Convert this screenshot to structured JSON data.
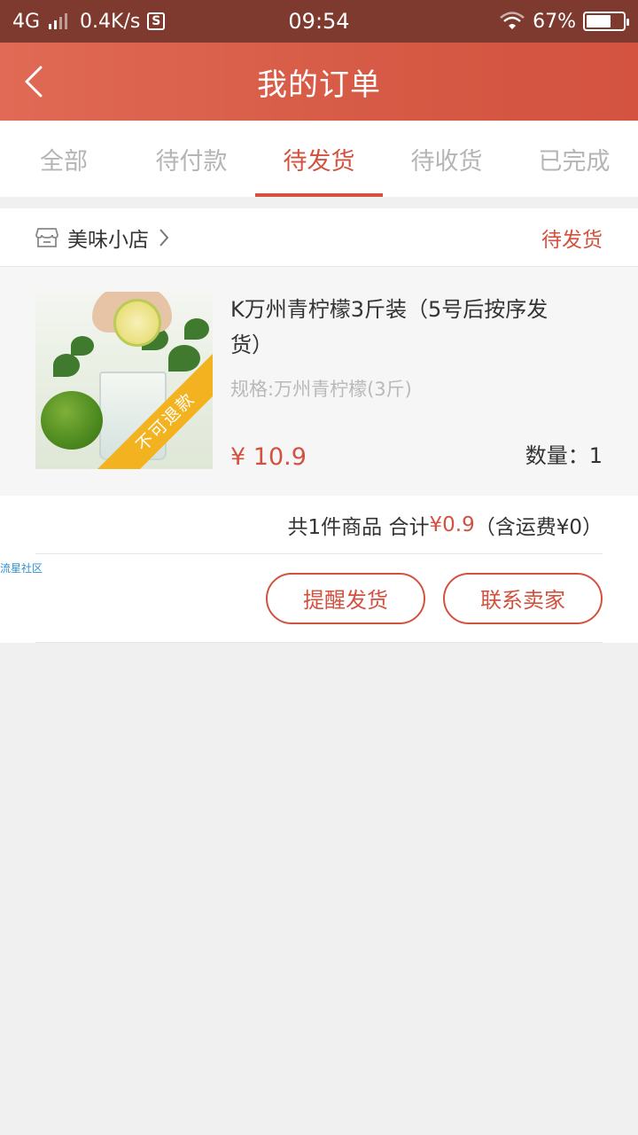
{
  "status_bar": {
    "network": "4G",
    "speed": "0.4K/s",
    "sim_icon": "S",
    "time": "09:54",
    "battery": "67%",
    "battery_level": 0.67
  },
  "nav": {
    "title": "我的订单",
    "back_icon": "chevron-left-icon"
  },
  "tabs": [
    {
      "label": "全部",
      "active": false
    },
    {
      "label": "待付款",
      "active": false
    },
    {
      "label": "待发货",
      "active": true
    },
    {
      "label": "待收货",
      "active": false
    },
    {
      "label": "已完成",
      "active": false
    }
  ],
  "order": {
    "shop_name": "美味小店",
    "status": "待发货",
    "product": {
      "title": "K万州青柠檬3斤装（5号后按序发货）",
      "spec": "规格:万州青柠檬(3斤)",
      "price": "¥ 10.9",
      "quantity": "数量：1",
      "ribbon": "不可退款"
    },
    "summary": {
      "count_text": "共1件商品 合计",
      "total": "¥0.9",
      "shipping": "（含运费¥0）"
    },
    "buttons": {
      "remind": "提醒发货",
      "contact": "联系卖家"
    }
  },
  "watermark": "流星社区",
  "colors": {
    "accent": "#d2523f",
    "status_bar": "#7e3a2e",
    "ribbon": "#f3b220"
  }
}
